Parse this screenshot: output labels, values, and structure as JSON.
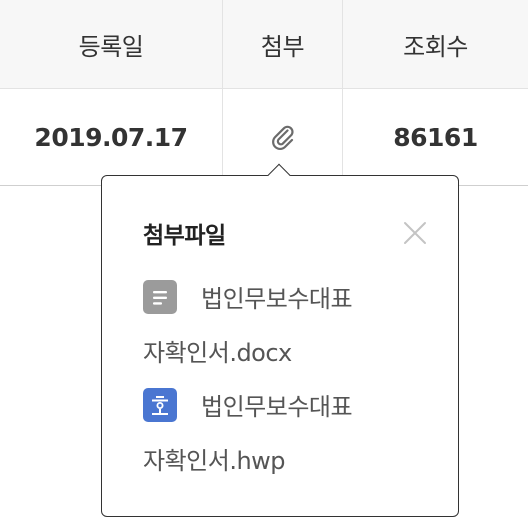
{
  "table": {
    "headers": [
      "등록일",
      "첨부",
      "조회수"
    ],
    "row": {
      "date": "2019.07.17",
      "views": "86161"
    }
  },
  "popover": {
    "title": "첨부파일",
    "files": [
      {
        "name": "법인무보수대표자확인서.docx",
        "name_line1": "법인무보수대표",
        "name_line2": "자확인서.docx",
        "icon": "doc-file-icon",
        "icon_color": "#9b9b9b"
      },
      {
        "name": "법인무보수대표자확인서.hwp",
        "name_line1": "법인무보수대표",
        "name_line2": "자확인서.hwp",
        "icon": "hwp-file-icon",
        "icon_color": "#4a76d1"
      }
    ]
  }
}
